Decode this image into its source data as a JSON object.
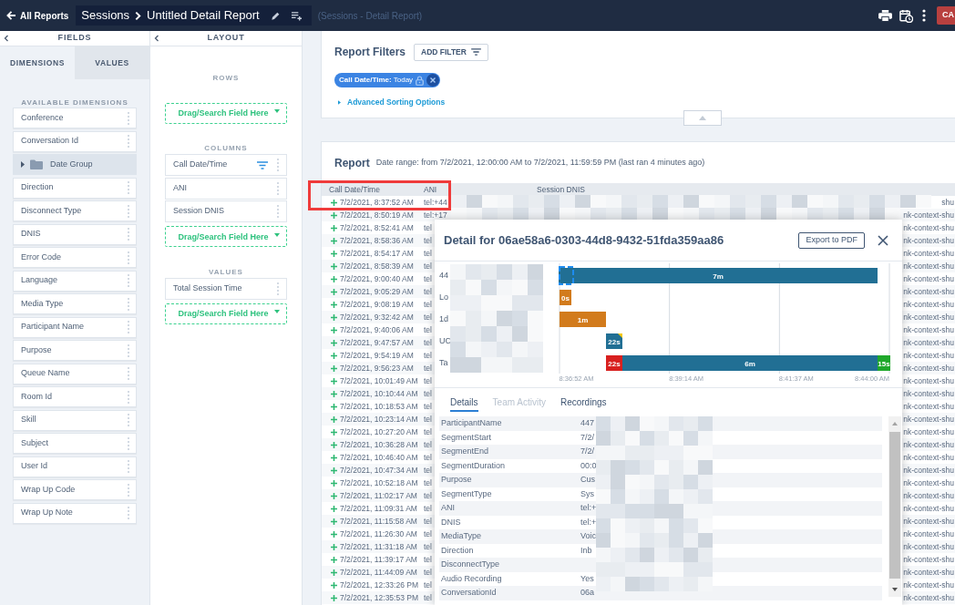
{
  "top_bar": {
    "back_link": "All Reports",
    "breadcrumb": [
      "Sessions",
      "Untitled Detail Report"
    ],
    "subtitle": "(Sessions - Detail Report)",
    "action_button": "CA"
  },
  "fields_panel": {
    "title": "FIELDS",
    "tabs": [
      {
        "label": "DIMENSIONS",
        "selected": true
      },
      {
        "label": "VALUES",
        "selected": false
      }
    ],
    "section_label": "AVAILABLE DIMENSIONS",
    "items": [
      {
        "kind": "field",
        "label": "Conference"
      },
      {
        "kind": "field",
        "label": "Conversation Id"
      },
      {
        "kind": "group",
        "label": "Date Group",
        "expanded": false
      },
      {
        "kind": "field",
        "label": "Direction"
      },
      {
        "kind": "field",
        "label": "Disconnect Type"
      },
      {
        "kind": "field",
        "label": "DNIS"
      },
      {
        "kind": "field",
        "label": "Error Code"
      },
      {
        "kind": "field",
        "label": "Language"
      },
      {
        "kind": "field",
        "label": "Media Type"
      },
      {
        "kind": "field",
        "label": "Participant Name"
      },
      {
        "kind": "field",
        "label": "Purpose"
      },
      {
        "kind": "field",
        "label": "Queue Name"
      },
      {
        "kind": "field",
        "label": "Room Id"
      },
      {
        "kind": "field",
        "label": "Skill"
      },
      {
        "kind": "field",
        "label": "Subject"
      },
      {
        "kind": "field",
        "label": "User Id"
      },
      {
        "kind": "field",
        "label": "Wrap Up Code"
      },
      {
        "kind": "field",
        "label": "Wrap Up Note"
      }
    ]
  },
  "layout_panel": {
    "title": "LAYOUT",
    "sections": [
      {
        "label": "ROWS",
        "drop_zone": {
          "placeholder": "Drag/Search Field Here"
        }
      },
      {
        "label": "COLUMNS",
        "items": [
          {
            "label": "Call Date/Time",
            "filtered": true
          },
          {
            "label": "ANI",
            "filtered": false
          },
          {
            "label": "Session DNIS",
            "filtered": false
          }
        ],
        "drop_zone": {
          "placeholder": "Drag/Search Field Here"
        }
      },
      {
        "label": "VALUES",
        "items": [
          {
            "label": "Total Session Time",
            "filtered": false
          }
        ],
        "drop_zone": {
          "placeholder": "Drag/Search Field Here"
        }
      }
    ]
  },
  "report_filters": {
    "title": "Report Filters",
    "add_filter_button": "ADD FILTER",
    "chips": [
      {
        "text": "**Call Date/Time:** Today"
      }
    ],
    "advanced_sorting_link": "Advanced Sorting Options"
  },
  "report": {
    "title": "Report",
    "date_range": "Date range: from 7/2/2021, 12:00:00 AM to 7/2/2021, 11:59:59 PM (last ran 4 minutes ago)",
    "table": {
      "columns": [
        "Call Date/Time",
        "ANI",
        "Session DNIS"
      ],
      "rows": [
        {
          "call_date_time": "7/2/2021, 8:37:52 AM",
          "ani": "tel:+44",
          "session_dnis": "shu"
        },
        {
          "call_date_time": "7/2/2021, 8:50:19 AM",
          "ani": "tel:+17",
          "session_dnis": "nk-context-shu"
        },
        {
          "call_date_time": "7/2/2021, 8:52:41 AM",
          "ani": "tel",
          "session_dnis": "nk-context-shu"
        },
        {
          "call_date_time": "7/2/2021, 8:58:36 AM",
          "ani": "tel",
          "session_dnis": "nk-context-shu"
        },
        {
          "call_date_time": "7/2/2021, 8:54:17 AM",
          "ani": "tel",
          "session_dnis": "nk-context-shu"
        },
        {
          "call_date_time": "7/2/2021, 8:58:39 AM",
          "ani": "tel",
          "session_dnis": "nk-context-shu"
        },
        {
          "call_date_time": "7/2/2021, 9:00:40 AM",
          "ani": "tel",
          "session_dnis": "nk-context-shu"
        },
        {
          "call_date_time": "7/2/2021, 9:05:29 AM",
          "ani": "tel",
          "session_dnis": "nk-context-shu"
        },
        {
          "call_date_time": "7/2/2021, 9:08:19 AM",
          "ani": "tel",
          "session_dnis": "nk-context-shu"
        },
        {
          "call_date_time": "7/2/2021, 9:32:42 AM",
          "ani": "tel",
          "session_dnis": "nk-context-shu"
        },
        {
          "call_date_time": "7/2/2021, 9:40:06 AM",
          "ani": "tel",
          "session_dnis": "nk-context-shu"
        },
        {
          "call_date_time": "7/2/2021, 9:47:57 AM",
          "ani": "tel",
          "session_dnis": "nk-context-shu"
        },
        {
          "call_date_time": "7/2/2021, 9:54:19 AM",
          "ani": "tel",
          "session_dnis": "nk-context-shu"
        },
        {
          "call_date_time": "7/2/2021, 9:56:23 AM",
          "ani": "tel",
          "session_dnis": "nk-context-shu"
        },
        {
          "call_date_time": "7/2/2021, 10:01:49 AM",
          "ani": "tel",
          "session_dnis": "nk-context-shu"
        },
        {
          "call_date_time": "7/2/2021, 10:10:44 AM",
          "ani": "tel",
          "session_dnis": "nk-context-shu"
        },
        {
          "call_date_time": "7/2/2021, 10:18:53 AM",
          "ani": "tel",
          "session_dnis": "nk-context-shu"
        },
        {
          "call_date_time": "7/2/2021, 10:23:14 AM",
          "ani": "tel",
          "session_dnis": "nk-context-shu"
        },
        {
          "call_date_time": "7/2/2021, 10:27:20 AM",
          "ani": "tel",
          "session_dnis": "nk-context-shu"
        },
        {
          "call_date_time": "7/2/2021, 10:36:28 AM",
          "ani": "tel",
          "session_dnis": "nk-context-shu"
        },
        {
          "call_date_time": "7/2/2021, 10:46:40 AM",
          "ani": "tel",
          "session_dnis": "nk-context-shu"
        },
        {
          "call_date_time": "7/2/2021, 10:47:34 AM",
          "ani": "tel",
          "session_dnis": "nk-context-shu"
        },
        {
          "call_date_time": "7/2/2021, 10:52:18 AM",
          "ani": "tel",
          "session_dnis": "nk-context-shu"
        },
        {
          "call_date_time": "7/2/2021, 11:02:17 AM",
          "ani": "tel",
          "session_dnis": "nk-context-shu"
        },
        {
          "call_date_time": "7/2/2021, 11:09:31 AM",
          "ani": "tel",
          "session_dnis": "nk-context-shu"
        },
        {
          "call_date_time": "7/2/2021, 11:15:58 AM",
          "ani": "tel",
          "session_dnis": "nk-context-shu"
        },
        {
          "call_date_time": "7/2/2021, 11:26:30 AM",
          "ani": "tel",
          "session_dnis": "nk-context-shu"
        },
        {
          "call_date_time": "7/2/2021, 11:31:18 AM",
          "ani": "tel",
          "session_dnis": "nk-context-shu"
        },
        {
          "call_date_time": "7/2/2021, 11:39:17 AM",
          "ani": "tel",
          "session_dnis": "nk-context-shu"
        },
        {
          "call_date_time": "7/2/2021, 11:44:09 AM",
          "ani": "tel",
          "session_dnis": "nk-context-shu"
        },
        {
          "call_date_time": "7/2/2021, 12:33:26 PM",
          "ani": "tel",
          "session_dnis": "nk-context-shu"
        },
        {
          "call_date_time": "7/2/2021, 12:35:53 PM",
          "ani": "tel",
          "session_dnis": "nk-context-shu"
        }
      ]
    }
  },
  "detail_dialog": {
    "title": "Detail for 06ae58a6-0303-44d8-9432-51fda359aa86",
    "export_button": "Export to PDF",
    "timeline": {
      "rows": [
        {
          "label": "44",
          "segments": [
            {
              "label": "7m",
              "color": "#216f94",
              "selected": true,
              "flagged": false
            }
          ]
        },
        {
          "label": "Lo",
          "segments": [
            {
              "label": "0s",
              "color": "#d27b1c",
              "selected": false,
              "flagged": false
            }
          ]
        },
        {
          "label": "1d",
          "segments": [
            {
              "label": "1m",
              "color": "#d27b1c",
              "selected": false,
              "flagged": false
            }
          ]
        },
        {
          "label": "UC",
          "segments": [
            {
              "label": "22s",
              "color": "#216f94",
              "selected": false,
              "flagged": true
            }
          ]
        },
        {
          "label": "Ta",
          "segments": [
            {
              "label": "22s",
              "color": "#d8201f",
              "selected": false,
              "flagged": false
            },
            {
              "label": "6m",
              "color": "#216f94",
              "selected": false,
              "flagged": false
            },
            {
              "label": "15s",
              "color": "#1fa82b",
              "selected": false,
              "flagged": false
            }
          ]
        }
      ],
      "ticks": [
        "8:36:52 AM",
        "8:39:14 AM",
        "8:41:37 AM",
        "8:44:00 AM"
      ]
    },
    "tabs": [
      {
        "label": "Details",
        "selected": true,
        "disabled": false
      },
      {
        "label": "Team Activity",
        "selected": false,
        "disabled": true
      },
      {
        "label": "Recordings",
        "selected": false,
        "disabled": false
      }
    ],
    "details": [
      {
        "key": "ParticipantName",
        "value": "447"
      },
      {
        "key": "SegmentStart",
        "value": "7/2/"
      },
      {
        "key": "SegmentEnd",
        "value": "7/2/"
      },
      {
        "key": "SegmentDuration",
        "value": "00:0"
      },
      {
        "key": "Purpose",
        "value": "Cus"
      },
      {
        "key": "SegmentType",
        "value": "Sys"
      },
      {
        "key": "ANI",
        "value": "tel:+"
      },
      {
        "key": "DNIS",
        "value": "tel:+"
      },
      {
        "key": "MediaType",
        "value": "Voic"
      },
      {
        "key": "Direction",
        "value": "Inb"
      },
      {
        "key": "DisconnectType"
      },
      {
        "key": "Audio Recording",
        "value": "Yes"
      },
      {
        "key": "ConversationId",
        "value": "06a"
      }
    ]
  }
}
